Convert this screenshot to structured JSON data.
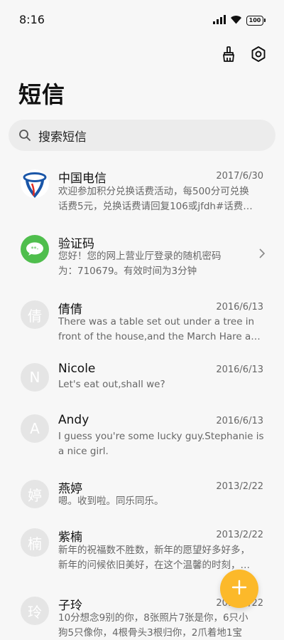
{
  "status_bar": {
    "time": "8:16",
    "battery": "100"
  },
  "header": {
    "title": "短信",
    "actions": [
      {
        "icon": "broom-icon"
      },
      {
        "icon": "settings-icon"
      }
    ]
  },
  "search": {
    "placeholder": "搜索短信"
  },
  "messages": [
    {
      "name": "中国电信",
      "date": "2017/6/30",
      "avatar_type": "logo",
      "preview": [
        "欢迎参加积分兑换话费活动，每500分可兑换",
        "话费5元，兑换话费请回复106或jfdh#话费…"
      ]
    },
    {
      "name": "验证码",
      "date": "",
      "avatar_type": "verify",
      "preview": [
        "您好！您的网上营业厅登录的随机密码",
        "为：710679。有效时间为3分钟"
      ]
    },
    {
      "name": "倩倩",
      "date": "2016/6/13",
      "avatar_letter": "倩",
      "preview": [
        "There was a table set out under a tree in",
        "front of the house,and the March Hare an…"
      ]
    },
    {
      "name": "Nicole",
      "date": "2016/6/13",
      "avatar_letter": "N",
      "preview": [
        "Let's eat out,shall we?"
      ]
    },
    {
      "name": "Andy",
      "date": "2016/6/13",
      "avatar_letter": "A",
      "preview": [
        "I guess you're some lucky guy.Stephanie is",
        "a nice girl."
      ]
    },
    {
      "name": "燕婷",
      "date": "2013/2/22",
      "avatar_letter": "婷",
      "preview": [
        "嗯。收到啦。同乐同乐。"
      ]
    },
    {
      "name": "紫楠",
      "date": "2013/2/22",
      "avatar_letter": "楠",
      "preview": [
        "新年的祝福数不胜数，新年的愿望好多好多，",
        "新年的问候依旧美好，在这个温馨的时刻，…"
      ]
    },
    {
      "name": "子玲",
      "date": "2013/2/22",
      "avatar_letter": "玲",
      "preview": [
        "10分想念9别的你，8张照片7张是你，6只小",
        "狗5只像你，4根骨头3根归你，2爪着地1宝"
      ]
    }
  ],
  "fab": {
    "icon": "plus-icon",
    "color": "#fcb92a"
  }
}
